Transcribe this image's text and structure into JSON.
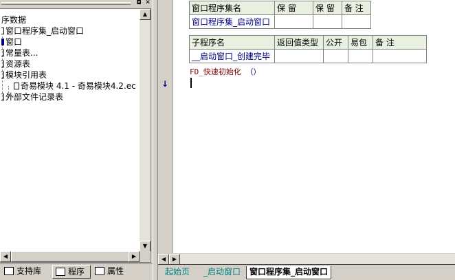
{
  "left_panel": {
    "pin_icon": "pin-icon",
    "close_icon": "close-icon",
    "tree": [
      {
        "label": "序数据",
        "icon": "none"
      },
      {
        "label": "窗口程序集_启动窗口",
        "icon": "module-icon"
      },
      {
        "label": "窗口",
        "icon": "window-icon"
      },
      {
        "label": "常量表...",
        "icon": "constant-icon"
      },
      {
        "label": "资源表",
        "icon": "resource-icon"
      },
      {
        "label": "模块引用表",
        "icon": "module-ref-icon"
      },
      {
        "label": "奇易模块 4.1 - 奇易模块4.2.ec",
        "icon": "file-icon"
      },
      {
        "label": "外部文件记录表",
        "icon": "file-list-icon"
      }
    ],
    "tabs": [
      "支持库",
      "程序",
      "属性"
    ]
  },
  "code": {
    "assembly_table": {
      "headers": [
        "窗口程序集名",
        "保 留",
        "保 留",
        "备 注"
      ],
      "row": [
        "窗口程序集_启动窗口",
        "",
        "",
        ""
      ]
    },
    "sub_table": {
      "headers": [
        "子程序名",
        "返回值类型",
        "公开",
        "易包",
        "备 注"
      ],
      "row": [
        "__启动窗口_创建完毕",
        "",
        "",
        "",
        ""
      ]
    },
    "line_fn": "FD_快速初始化",
    "line_paren": "（）",
    "arrow": "↓"
  },
  "bottom_tabs": [
    "起始页",
    "_启动窗口",
    "窗口程序集_启动窗口"
  ],
  "colors": {
    "tab_inactive": "#008080",
    "header_bg": "#e8f0e0",
    "value_text": "#000080",
    "fn_text": "#800000"
  }
}
